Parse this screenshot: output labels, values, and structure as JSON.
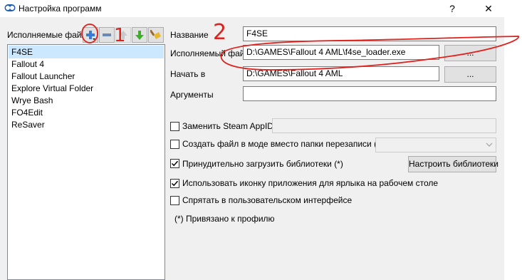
{
  "window": {
    "title": "Настройка программ",
    "help_glyph": "?",
    "close_glyph": "✕"
  },
  "left": {
    "executables_label": "Исполняемые файлы",
    "items": [
      {
        "label": "F4SE",
        "selected": true
      },
      {
        "label": "Fallout 4"
      },
      {
        "label": "Fallout Launcher"
      },
      {
        "label": "Explore Virtual Folder"
      },
      {
        "label": "Wrye Bash"
      },
      {
        "label": "FO4Edit"
      },
      {
        "label": "ReSaver"
      }
    ]
  },
  "form": {
    "name_label": "Название",
    "name_value": "F4SE",
    "binary_label": "Исполняемый файл",
    "binary_value": "D:\\GAMES\\Fallout 4  AML\\f4se_loader.exe",
    "browse_label": "...",
    "start_in_label": "Начать в",
    "start_in_value": "D:\\GAMES\\Fallout 4  AML",
    "browse2_label": "...",
    "arguments_label": "Аргументы",
    "arguments_value": ""
  },
  "options": {
    "steam_appid_label": "Заменить Steam AppID",
    "steam_appid_checked": false,
    "steam_appid_value": "",
    "create_file_label": "Создать файл в моде вместо папки перезаписи (*)",
    "create_file_checked": false,
    "force_libs_label": "Принудительно загрузить библиотеки (*)",
    "force_libs_checked": true,
    "configure_libs_label": "Настроить библиотеки",
    "use_icon_label": "Использовать иконку приложения для ярлыка на рабочем столе",
    "use_icon_checked": true,
    "hide_ui_label": "Спрятать в пользовательском интерфейсе",
    "hide_ui_checked": false,
    "profile_note": "(*) Привязано к профилю"
  },
  "annotations": {
    "mark_1": "1",
    "mark_2": "2"
  },
  "colors": {
    "selection": "#cce8ff",
    "annotation_red": "#e0201b",
    "add_icon": "#3a7bd5",
    "remove_icon": "#6a8ab5",
    "arrow_green": "#3fae2a"
  },
  "icons": [
    "app-icon",
    "add-icon",
    "remove-icon",
    "move-up-icon",
    "move-down-icon",
    "broom-icon",
    "checkmark-icon",
    "chevron-down-icon"
  ]
}
